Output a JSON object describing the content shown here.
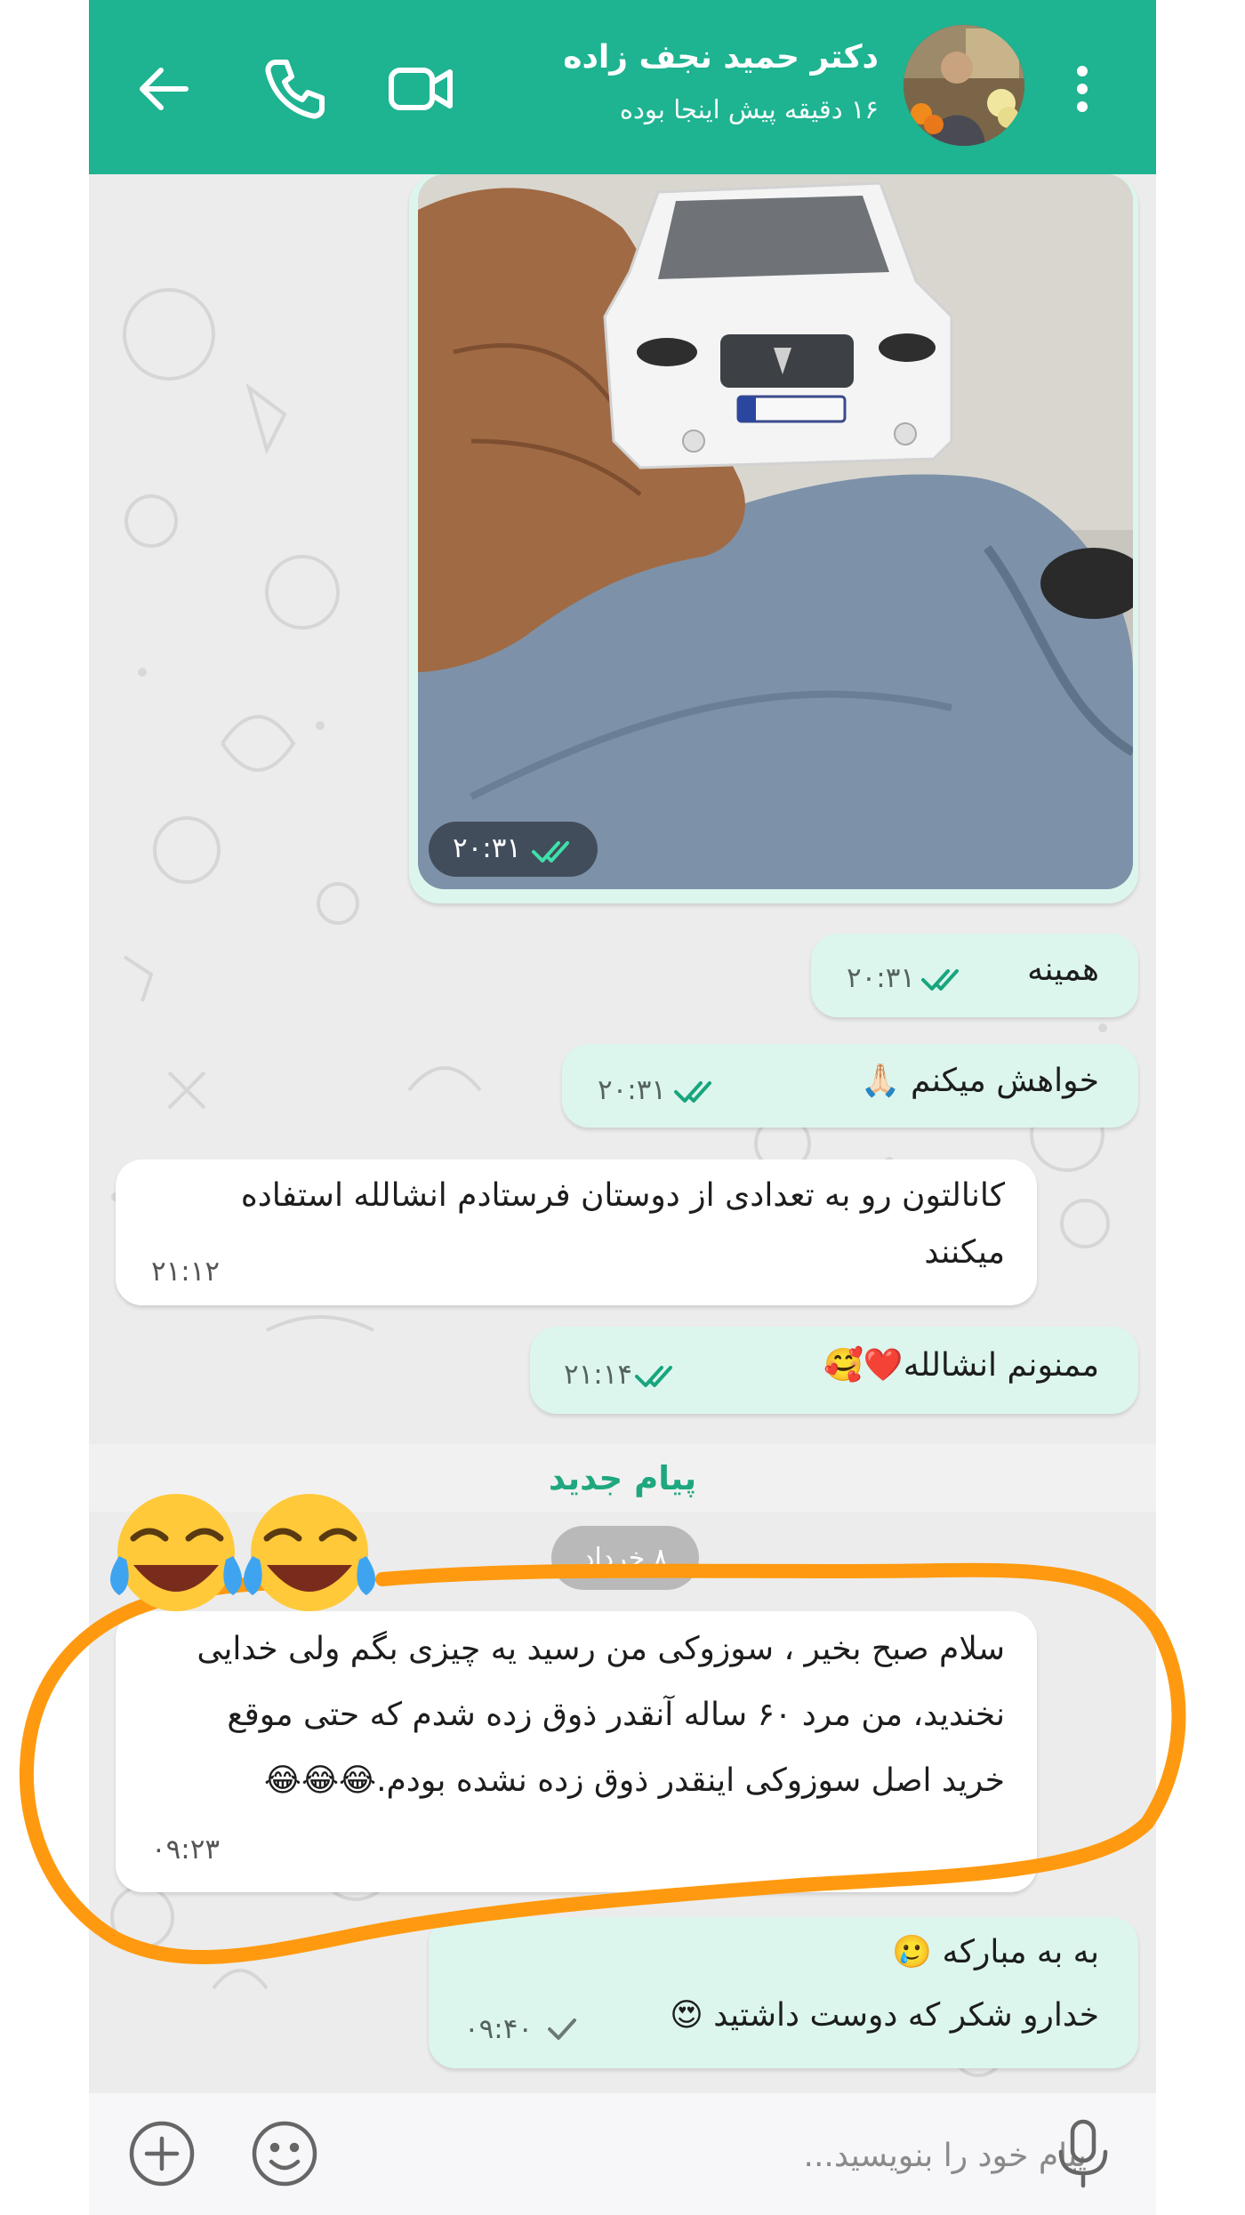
{
  "header": {
    "contact_name": "دکتر حمید نجف زاده",
    "last_seen": "۱۶ دقیقه پیش اینجا بوده",
    "icons": [
      "back-arrow-icon",
      "phone-icon",
      "video-call-icon",
      "more-vert-icon"
    ],
    "background_color": "#1eb391"
  },
  "messages": [
    {
      "type": "image",
      "direction": "out",
      "time": "۲۰:۳۱",
      "status": "read"
    },
    {
      "type": "text",
      "direction": "out",
      "text": "همینه",
      "time": "۲۰:۳۱",
      "status": "read"
    },
    {
      "type": "text",
      "direction": "out",
      "text": "خواهش میکنم 🙏🏻",
      "time": "۲۰:۳۱",
      "status": "read"
    },
    {
      "type": "text",
      "direction": "in",
      "lines": [
        "کانالتون رو به تعدادی از دوستان فرستادم انشالله استفاده",
        "میکنند"
      ],
      "time": "۲۱:۱۲"
    },
    {
      "type": "text",
      "direction": "out",
      "text": "ممنونم انشالله❤️🥰",
      "time": "۲۱:۱۴",
      "status": "read"
    },
    {
      "type": "text",
      "direction": "in",
      "lines": [
        "سلام صبح بخیر ، سوزوکی من رسید یه چیزی بگم ولی خدایی",
        "نخندید، من مرد ۶۰ ساله آنقدر ذوق زده شدم که حتی موقع",
        "خرید اصل سوزوکی اینقدر ذوق زده نشده بودم.😂😂😂"
      ],
      "time": "۰۹:۲۳",
      "highlighted": true
    },
    {
      "type": "text",
      "direction": "out",
      "lines": [
        "به به مبارکه 🥲",
        "خدارو شکر که دوست داشتید 😍"
      ],
      "time": "۰۹:۴۰",
      "status": "sent"
    }
  ],
  "new_messages_label": "پیام جدید",
  "date_separator": "۸ خرداد",
  "input": {
    "placeholder": "پیام خود را بنویسید...",
    "value": "",
    "icons": [
      "microphone-icon",
      "emoji-icon",
      "add-attachment-icon"
    ]
  },
  "colors": {
    "outgoing_bubble": "#dcf6ee",
    "incoming_bubble": "#ffffff",
    "accent": "#1fa77f",
    "annotation": "#ff9a10"
  }
}
